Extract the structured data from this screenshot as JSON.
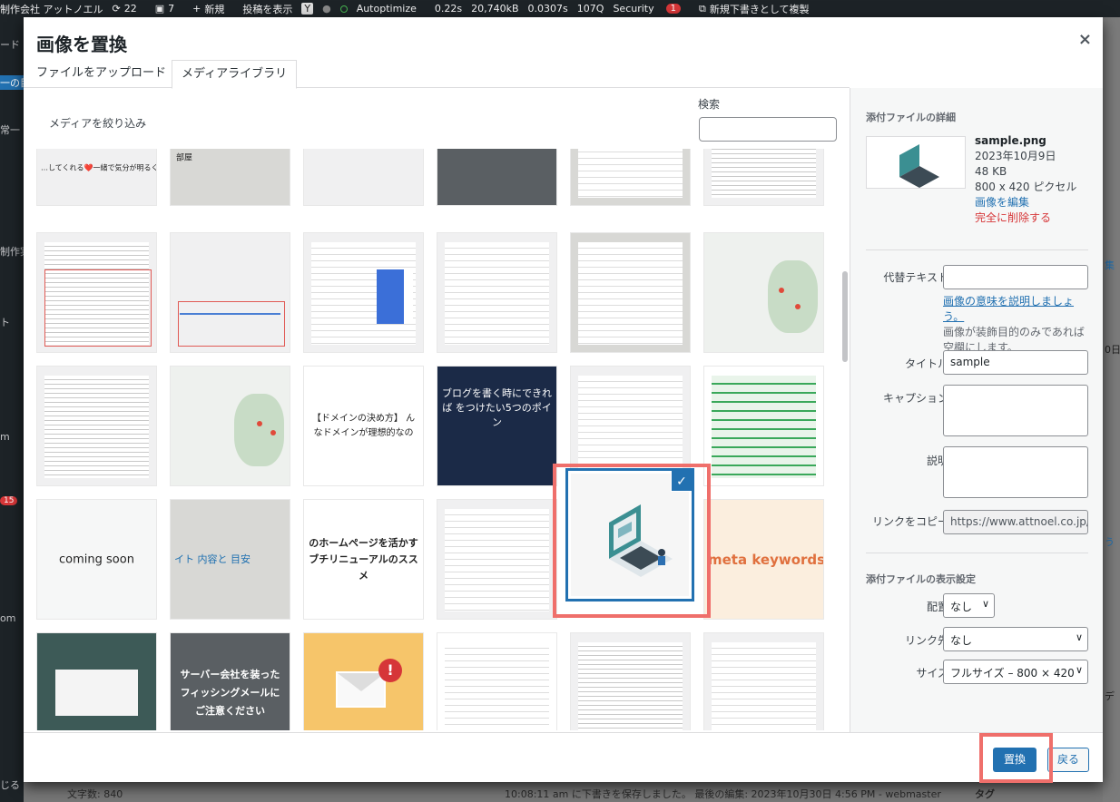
{
  "admin_bar": {
    "site_name": "制作会社 アットノエル",
    "updates_count": "22",
    "comments_count": "7",
    "new_label": "新規",
    "view_post_label": "投稿を表示",
    "autoptimize_label": "Autoptimize",
    "perf_time": "0.22s",
    "perf_memory": "20,740kB",
    "perf_query_time": "0.0307s",
    "perf_queries": "107Q",
    "security_label": "Security",
    "security_count": "1",
    "duplicate_label": "新規下書きとして複製"
  },
  "sidebar_fragments": [
    "ード",
    "一の目",
    "常一",
    "制作実",
    "ト",
    "m",
    "15",
    "om",
    "じる"
  ],
  "right_fragments": [
    "集",
    "0日",
    "う",
    "デ"
  ],
  "footer": {
    "word_count": "文字数: 840",
    "draft_status": "10:08:11 am に下書きを保存しました。 最後の編集: 2023年10月30日 4:56 PM - webmaster",
    "tag_label": "タグ"
  },
  "modal": {
    "title": "画像を置換",
    "close_symbol": "×",
    "tabs": [
      {
        "label": "ファイルをアップロード",
        "active": false
      },
      {
        "label": "メディアライブラリ",
        "active": true
      }
    ],
    "filter_label": "メディアを絞り込み",
    "search_label": "検索",
    "search_value": ""
  },
  "media_tiles": [
    {
      "style": "t-dark",
      "caption": "…してくれる❤️一緒で気分が明るくなる魔法のカップ"
    },
    {
      "style": "t-grey",
      "caption": "部屋"
    },
    {
      "style": "",
      "caption": ""
    },
    {
      "style": "t-city",
      "caption": ""
    },
    {
      "style": "t-grey",
      "caption": ""
    },
    {
      "style": "",
      "caption": ""
    },
    {
      "style": "",
      "caption": ""
    },
    {
      "style": "",
      "caption": ""
    },
    {
      "style": "",
      "caption": ""
    },
    {
      "style": "",
      "caption": ""
    },
    {
      "style": "t-grey",
      "caption": ""
    },
    {
      "style": "t-map",
      "caption": ""
    },
    {
      "style": "",
      "caption": ""
    },
    {
      "style": "t-map",
      "caption": ""
    },
    {
      "style": "",
      "caption": "【ドメインの決め方】 んなドメインが理想的なの"
    },
    {
      "style": "t-dark",
      "caption": "ブログを書く時にできれば をつけたい5つのポイン"
    },
    {
      "style": "",
      "caption": ""
    },
    {
      "style": "",
      "caption": ""
    },
    {
      "style": "",
      "caption": "coming soon"
    },
    {
      "style": "t-grey",
      "caption": "イト 内容と 目安"
    },
    {
      "style": "",
      "caption": "のホームページを活かす ブチリニューアルのススメ"
    },
    {
      "style": "",
      "caption": ""
    },
    {
      "style": "",
      "caption": ""
    },
    {
      "style": "",
      "caption": "meta keywords"
    },
    {
      "style": "t-teal",
      "caption": ""
    },
    {
      "style": "t-city",
      "caption": "サーバー会社を装った フィッシングメールに ご注意ください"
    },
    {
      "style": "t-yellow",
      "caption": ""
    },
    {
      "style": "",
      "caption": ""
    },
    {
      "style": "",
      "caption": ""
    },
    {
      "style": "",
      "caption": ""
    }
  ],
  "selected_check": "✓",
  "details": {
    "heading": "添付ファイルの詳細",
    "filename": "sample.png",
    "date": "2023年10月9日",
    "size": "48 KB",
    "dimensions": "800 x 420 ピクセル",
    "edit_link": "画像を編集",
    "delete_link": "完全に削除する",
    "alt_label": "代替テキスト",
    "alt_value": "",
    "alt_help_link": "画像の意味を説明しましょう。",
    "alt_help_text": "画像が装飾目的のみであれば空欄にします。",
    "title_label": "タイトル",
    "title_value": "sample",
    "caption_label": "キャプション",
    "caption_value": "",
    "description_label": "説明",
    "description_value": "",
    "copy_link_label": "リンクをコピー",
    "copy_link_value": "https://www.attnoel.co.jp/",
    "display_heading": "添付ファイルの表示設定",
    "align_label": "配置",
    "align_value": "なし",
    "link_to_label": "リンク先",
    "link_to_value": "なし",
    "size_label": "サイズ",
    "size_value": "フルサイズ – 800 × 420"
  },
  "buttons": {
    "replace": "置換",
    "back": "戻る"
  },
  "colors": {
    "accent": "#2271b1",
    "highlight": "#ef6f6b",
    "danger": "#d63638"
  }
}
